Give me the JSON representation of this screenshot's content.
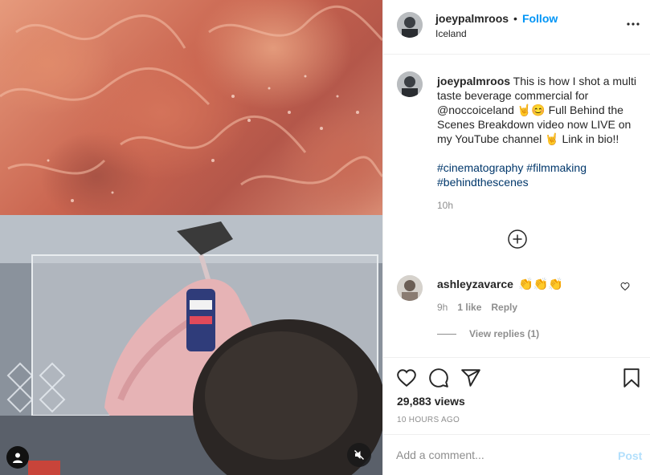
{
  "post": {
    "username": "joeypalmroos",
    "separator": "•",
    "follow_label": "Follow",
    "location": "Iceland",
    "more_icon": "more-options-icon"
  },
  "caption": {
    "username": "joeypalmroos",
    "text": "This is how I shot a multi taste beverage commercial for @noccoiceland 🤘😊 Full Behind the Scenes Breakdown video now LIVE on my YouTube channel 🤘 Link in bio!!",
    "hashtags": "#cinematography #filmmaking #behindthescenes",
    "time": "10h"
  },
  "comment": {
    "username": "ashleyzavarce",
    "emoji": "👏👏👏",
    "time": "9h",
    "likes": "1 like",
    "reply_label": "Reply",
    "view_replies": "View replies (1)"
  },
  "stats": {
    "views": "29,883 views",
    "time_ago": "10 HOURS AGO"
  },
  "add_comment": {
    "placeholder": "Add a comment...",
    "post_label": "Post"
  },
  "colors": {
    "accent": "#0095f6",
    "hashtag": "#00376b",
    "muted": "#8e8e8e",
    "post_disabled": "#b2dffc"
  }
}
